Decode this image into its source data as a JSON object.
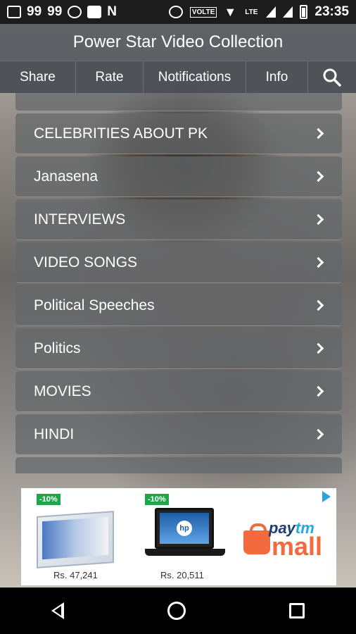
{
  "status_bar": {
    "notif_numbers": [
      "99",
      "99"
    ],
    "volte_label": "VOLTE",
    "lte_label": "LTE",
    "time": "23:35"
  },
  "app": {
    "title": "Power Star Video Collection"
  },
  "nav": {
    "share": "Share",
    "rate": "Rate",
    "notifications": "Notifications",
    "info": "Info"
  },
  "menu": {
    "items": [
      {
        "label": "CELEBRITIES ABOUT PK"
      },
      {
        "label": "Janasena"
      },
      {
        "label": "INTERVIEWS"
      },
      {
        "label": "VIDEO SONGS"
      },
      {
        "label": "Political Speeches"
      },
      {
        "label": "Politics"
      },
      {
        "label": "MOVIES"
      },
      {
        "label": "HINDI"
      }
    ]
  },
  "ad": {
    "badge1": "-10%",
    "price1": "Rs. 47,241",
    "badge2": "-10%",
    "price2": "Rs. 20,511",
    "brand_top_a": "pay",
    "brand_top_b": "tm",
    "brand_bottom": "mall",
    "laptop_logo": "hp"
  },
  "colors": {
    "accent_orange": "#f26a3d",
    "badge_green": "#1fa64a",
    "nav_bg": "#484c52"
  }
}
